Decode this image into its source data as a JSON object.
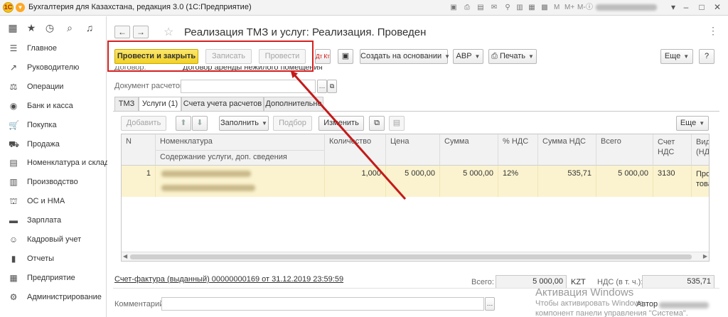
{
  "app": {
    "window_title": "Бухгалтерия для Казахстана, редакция 3.0  (1С:Предприятие)",
    "toolbar_text": [
      "M",
      "M+",
      "M-"
    ]
  },
  "sidebar": {
    "items": [
      {
        "label": "Главное",
        "icon": "menu-lines-icon"
      },
      {
        "label": "Руководителю",
        "icon": "trend-chart-icon"
      },
      {
        "label": "Операции",
        "icon": "scales-icon"
      },
      {
        "label": "Банк и касса",
        "icon": "bank-coin-icon"
      },
      {
        "label": "Покупка",
        "icon": "cart-icon"
      },
      {
        "label": "Продажа",
        "icon": "sale-cart-icon"
      },
      {
        "label": "Номенклатура и склад",
        "icon": "warehouse-icon"
      },
      {
        "label": "Производство",
        "icon": "factory-icon"
      },
      {
        "label": "ОС и НМА",
        "icon": "assets-icon"
      },
      {
        "label": "Зарплата",
        "icon": "salary-icon"
      },
      {
        "label": "Кадровый учет",
        "icon": "people-icon"
      },
      {
        "label": "Отчеты",
        "icon": "reports-icon"
      },
      {
        "label": "Предприятие",
        "icon": "enterprise-icon"
      },
      {
        "label": "Администрирование",
        "icon": "gear-icon"
      }
    ]
  },
  "document": {
    "title": "Реализация ТМЗ и услуг: Реализация. Проведен",
    "buttons": {
      "post_and_close": "Провести и закрыть",
      "save": "Записать",
      "post": "Провести",
      "create_based_on": "Создать на основании",
      "avr": "АВР",
      "print": "Печать",
      "more": "Еще",
      "help": "?"
    },
    "contract_label": "Договор:",
    "contract_value": "Договор аренды нежилого помещения",
    "settlement_doc_label": "Документ расчетов:",
    "settlement_doc_value": "",
    "tabs": [
      "ТМЗ",
      "Услуги (1)",
      "Счета учета расчетов",
      "Дополнительно"
    ],
    "table_toolbar": {
      "add": "Добавить",
      "fill": "Заполнить",
      "select": "Подбор",
      "change": "Изменить",
      "more": "Еще"
    },
    "table": {
      "headers": {
        "n": "N",
        "nomenclature": "Номенклатура",
        "service_content": "Содержание услуги, доп. сведения",
        "quantity": "Количество",
        "price": "Цена",
        "sum": "Сумма",
        "vat_rate": "% НДС",
        "vat_sum": "Сумма НДС",
        "total": "Всего",
        "vat_account": "Счет НДС",
        "kind": "Вид (НДС"
      },
      "rows": [
        {
          "n": "1",
          "quantity": "1,000",
          "price": "5 000,00",
          "sum": "5 000,00",
          "vat_rate": "12%",
          "vat_sum": "535,71",
          "total": "5 000,00",
          "vat_account": "3130",
          "kind": "Про това"
        }
      ]
    },
    "invoice_link": "Счет-фактура (выданный) 00000000169 от 31.12.2019 23:59:59",
    "totals": {
      "total_label": "Всего:",
      "total_value": "5 000,00",
      "currency": "KZT",
      "vat_label": "НДС (в т. ч.):",
      "vat_value": "535,71"
    },
    "comment_label": "Комментарий:",
    "comment_value": "",
    "author_label": "Автор"
  },
  "watermark": {
    "line1": "Активация Windows",
    "line2": "Чтобы активировать Windows",
    "line3": "компонент панели управления \"Система\"."
  },
  "colors": {
    "primary_button": "#f2d128",
    "highlight_row": "#fbf3cf",
    "annotation_red": "#d62020"
  }
}
